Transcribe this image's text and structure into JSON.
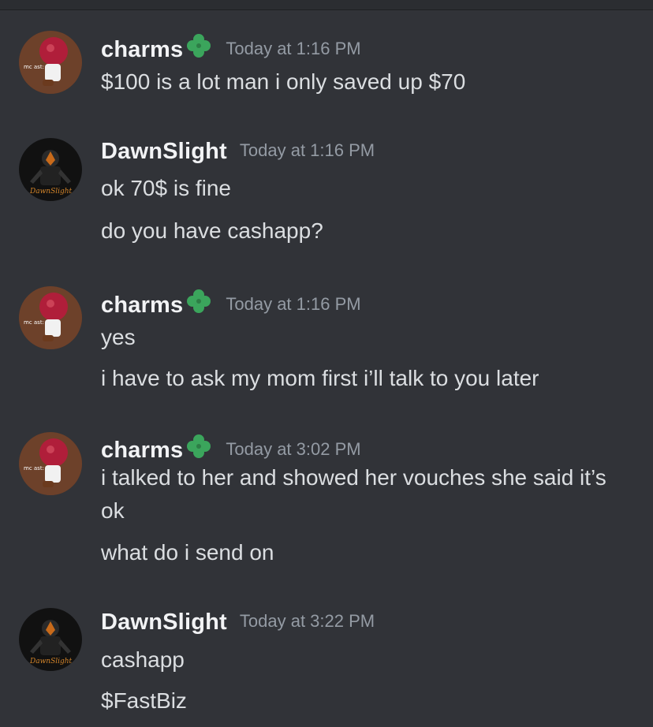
{
  "messages": [
    {
      "author": "charms",
      "avatar": "apple-mascot-avatar",
      "timestamp": "Today at 1:16 PM",
      "lines": [
        "$100 is a lot man i only saved up $70"
      ]
    },
    {
      "author": "DawnSlight",
      "avatar": "masked-figure-avatar",
      "timestamp": "Today at 1:16 PM",
      "lines": [
        "ok 70$ is fine",
        "do you have cashapp?"
      ]
    },
    {
      "author": "charms",
      "avatar": "apple-mascot-avatar",
      "timestamp": "Today at 1:16 PM",
      "lines": [
        "yes",
        "i have to ask my mom first i’ll talk to you later"
      ]
    },
    {
      "author": "charms",
      "avatar": "apple-mascot-avatar",
      "timestamp": "Today at 3:02 PM",
      "lines": [
        "i talked to her and showed her vouches she said it’s ok",
        "what do i send on"
      ]
    },
    {
      "author": "DawnSlight",
      "avatar": "masked-figure-avatar",
      "timestamp": "Today at 3:22 PM",
      "lines": [
        "cashapp",
        "$FastBiz"
      ]
    }
  ],
  "avatar_text": {
    "charms": "mc ast:",
    "dawnslight": "DawnSlight"
  },
  "badges": {
    "charms_badge_icon": "four-leaf-clover-icon"
  },
  "colors": {
    "background": "#313338",
    "username": "#f2f3f5",
    "timestamp": "#949ba4",
    "message_text": "#dbdee1",
    "clover": "#3ba55c"
  }
}
